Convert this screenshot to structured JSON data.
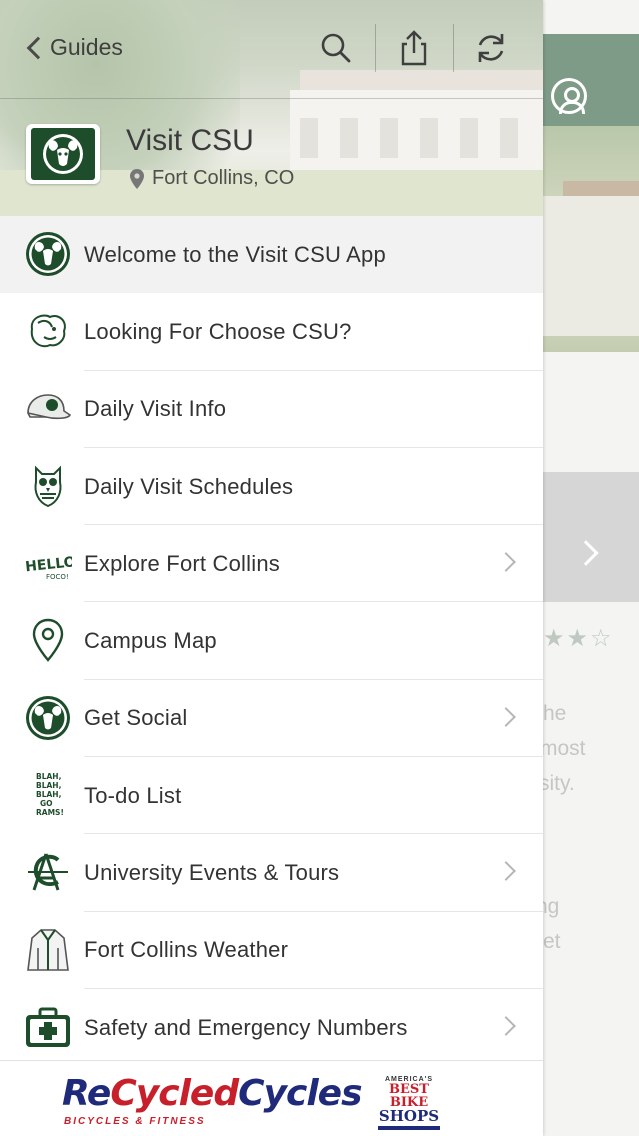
{
  "nav": {
    "back_label": "Guides",
    "search_icon": "search-icon",
    "share_icon": "share-icon",
    "refresh_icon": "refresh-icon"
  },
  "guide": {
    "title": "Visit CSU",
    "location": "Fort Collins, CO",
    "logo_icon": "csu-ram-logo"
  },
  "menu": {
    "items": [
      {
        "label": "Welcome to the Visit CSU App",
        "icon": "ram-logo-icon",
        "selected": true,
        "has_arrow": false
      },
      {
        "label": "Looking For Choose CSU?",
        "icon": "ram-mascot-icon",
        "selected": false,
        "has_arrow": false
      },
      {
        "label": "Daily Visit Info",
        "icon": "cap-icon",
        "selected": false,
        "has_arrow": false
      },
      {
        "label": "Daily Visit Schedules",
        "icon": "owl-icon",
        "selected": false,
        "has_arrow": false
      },
      {
        "label": "Explore Fort Collins",
        "icon": "hello-foco-icon",
        "selected": false,
        "has_arrow": true
      },
      {
        "label": "Campus Map",
        "icon": "map-pin-icon",
        "selected": false,
        "has_arrow": false
      },
      {
        "label": "Get Social",
        "icon": "ram-logo-icon",
        "selected": false,
        "has_arrow": true
      },
      {
        "label": "To-do List",
        "icon": "blah-text-icon",
        "selected": false,
        "has_arrow": false
      },
      {
        "label": "University Events & Tours",
        "icon": "ac-monogram-icon",
        "selected": false,
        "has_arrow": true
      },
      {
        "label": "Fort Collins Weather",
        "icon": "jacket-icon",
        "selected": false,
        "has_arrow": false
      },
      {
        "label": "Safety and Emergency Numbers",
        "icon": "first-aid-icon",
        "selected": false,
        "has_arrow": true
      }
    ],
    "blah_lines": [
      "BLAH,",
      "BLAH,",
      "BLAH,",
      "GO",
      "RAMS!"
    ],
    "hello_text": "HELLO!",
    "foco_text": "FOCO!"
  },
  "sponsor": {
    "name_part1": "Re",
    "name_part2": "Cycled",
    "name_part3": "Cycles",
    "tagline": "BICYCLES & FITNESS",
    "badge_top": "AMERICA'S",
    "badge_mid": "BEST BIKE",
    "badge_bottom": "SHOPS"
  },
  "background": {
    "text_lines": [
      "he",
      "most",
      "rsity.",
      "ng",
      "et"
    ],
    "stars": "★★☆"
  },
  "colors": {
    "brand_green": "#1e4d2b",
    "header_green": "#7d9b86",
    "sponsor_blue": "#1f2b7a",
    "sponsor_red": "#c8202b"
  }
}
